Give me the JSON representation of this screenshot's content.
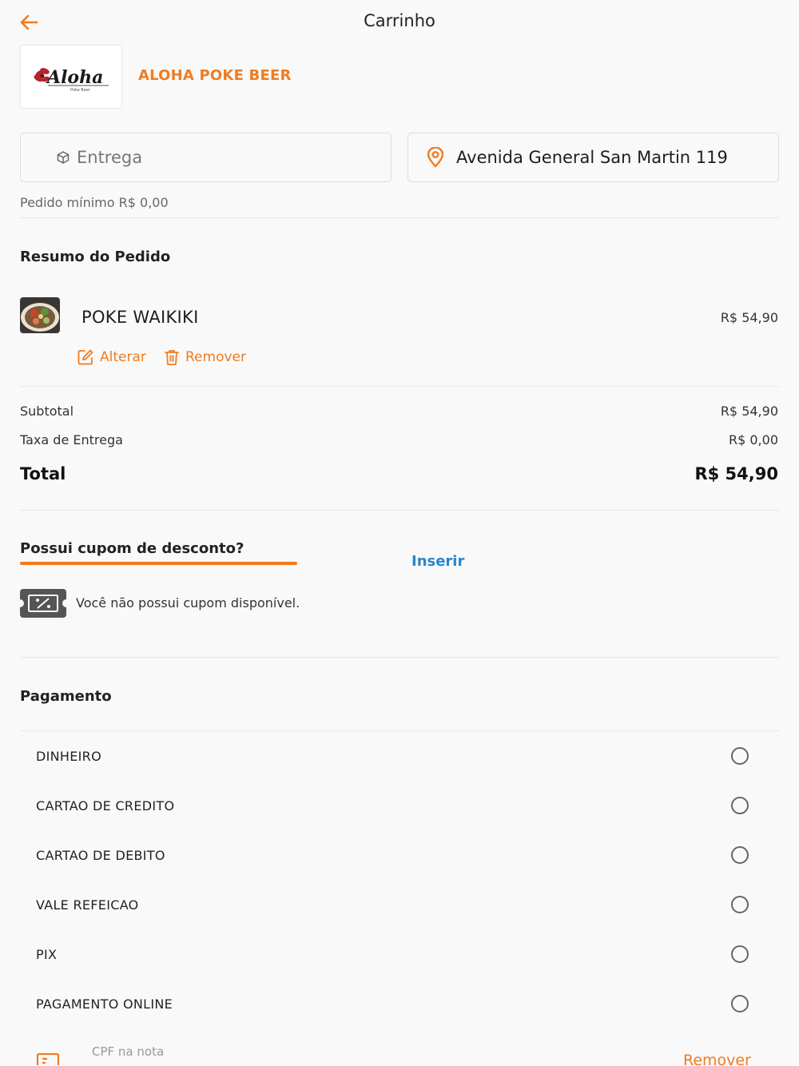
{
  "header": {
    "title": "Carrinho",
    "back_icon": "arrow-left-icon"
  },
  "store": {
    "name": "ALOHA POKE BEER",
    "logo_text": "Aloha",
    "logo_subtext": "Poke Beer"
  },
  "delivery": {
    "mode_label": "Entrega",
    "mode_icon": "package-icon",
    "address": "Avenida General San Martin 119",
    "address_icon": "location-pin-icon",
    "min_order": "Pedido mínimo R$ 0,00"
  },
  "summary": {
    "title": "Resumo do Pedido",
    "items": [
      {
        "name": "POKE WAIKIKI",
        "price": "R$ 54,90",
        "edit_label": "Alterar",
        "remove_label": "Remover"
      }
    ],
    "subtotal_label": "Subtotal",
    "subtotal_value": "R$ 54,90",
    "fee_label": "Taxa de Entrega",
    "fee_value": "R$ 0,00",
    "total_label": "Total",
    "total_value": "R$ 54,90"
  },
  "coupon": {
    "title": "Possui cupom de desconto?",
    "insert_label": "Inserir",
    "empty_message": "Você não possui cupom disponível."
  },
  "payment": {
    "title": "Pagamento",
    "options": [
      {
        "label": "DINHEIRO",
        "selected": false
      },
      {
        "label": "CARTAO DE CREDITO",
        "selected": false
      },
      {
        "label": "CARTAO DE DEBITO",
        "selected": false
      },
      {
        "label": "VALE REFEICAO",
        "selected": false
      },
      {
        "label": "PIX",
        "selected": false
      },
      {
        "label": "PAGAMENTO ONLINE",
        "selected": false
      }
    ]
  },
  "cpf": {
    "label": "CPF na nota",
    "remove_label": "Remover"
  },
  "colors": {
    "accent": "#ef7c21",
    "link": "#2a86c8",
    "background": "#f9f9f9"
  }
}
